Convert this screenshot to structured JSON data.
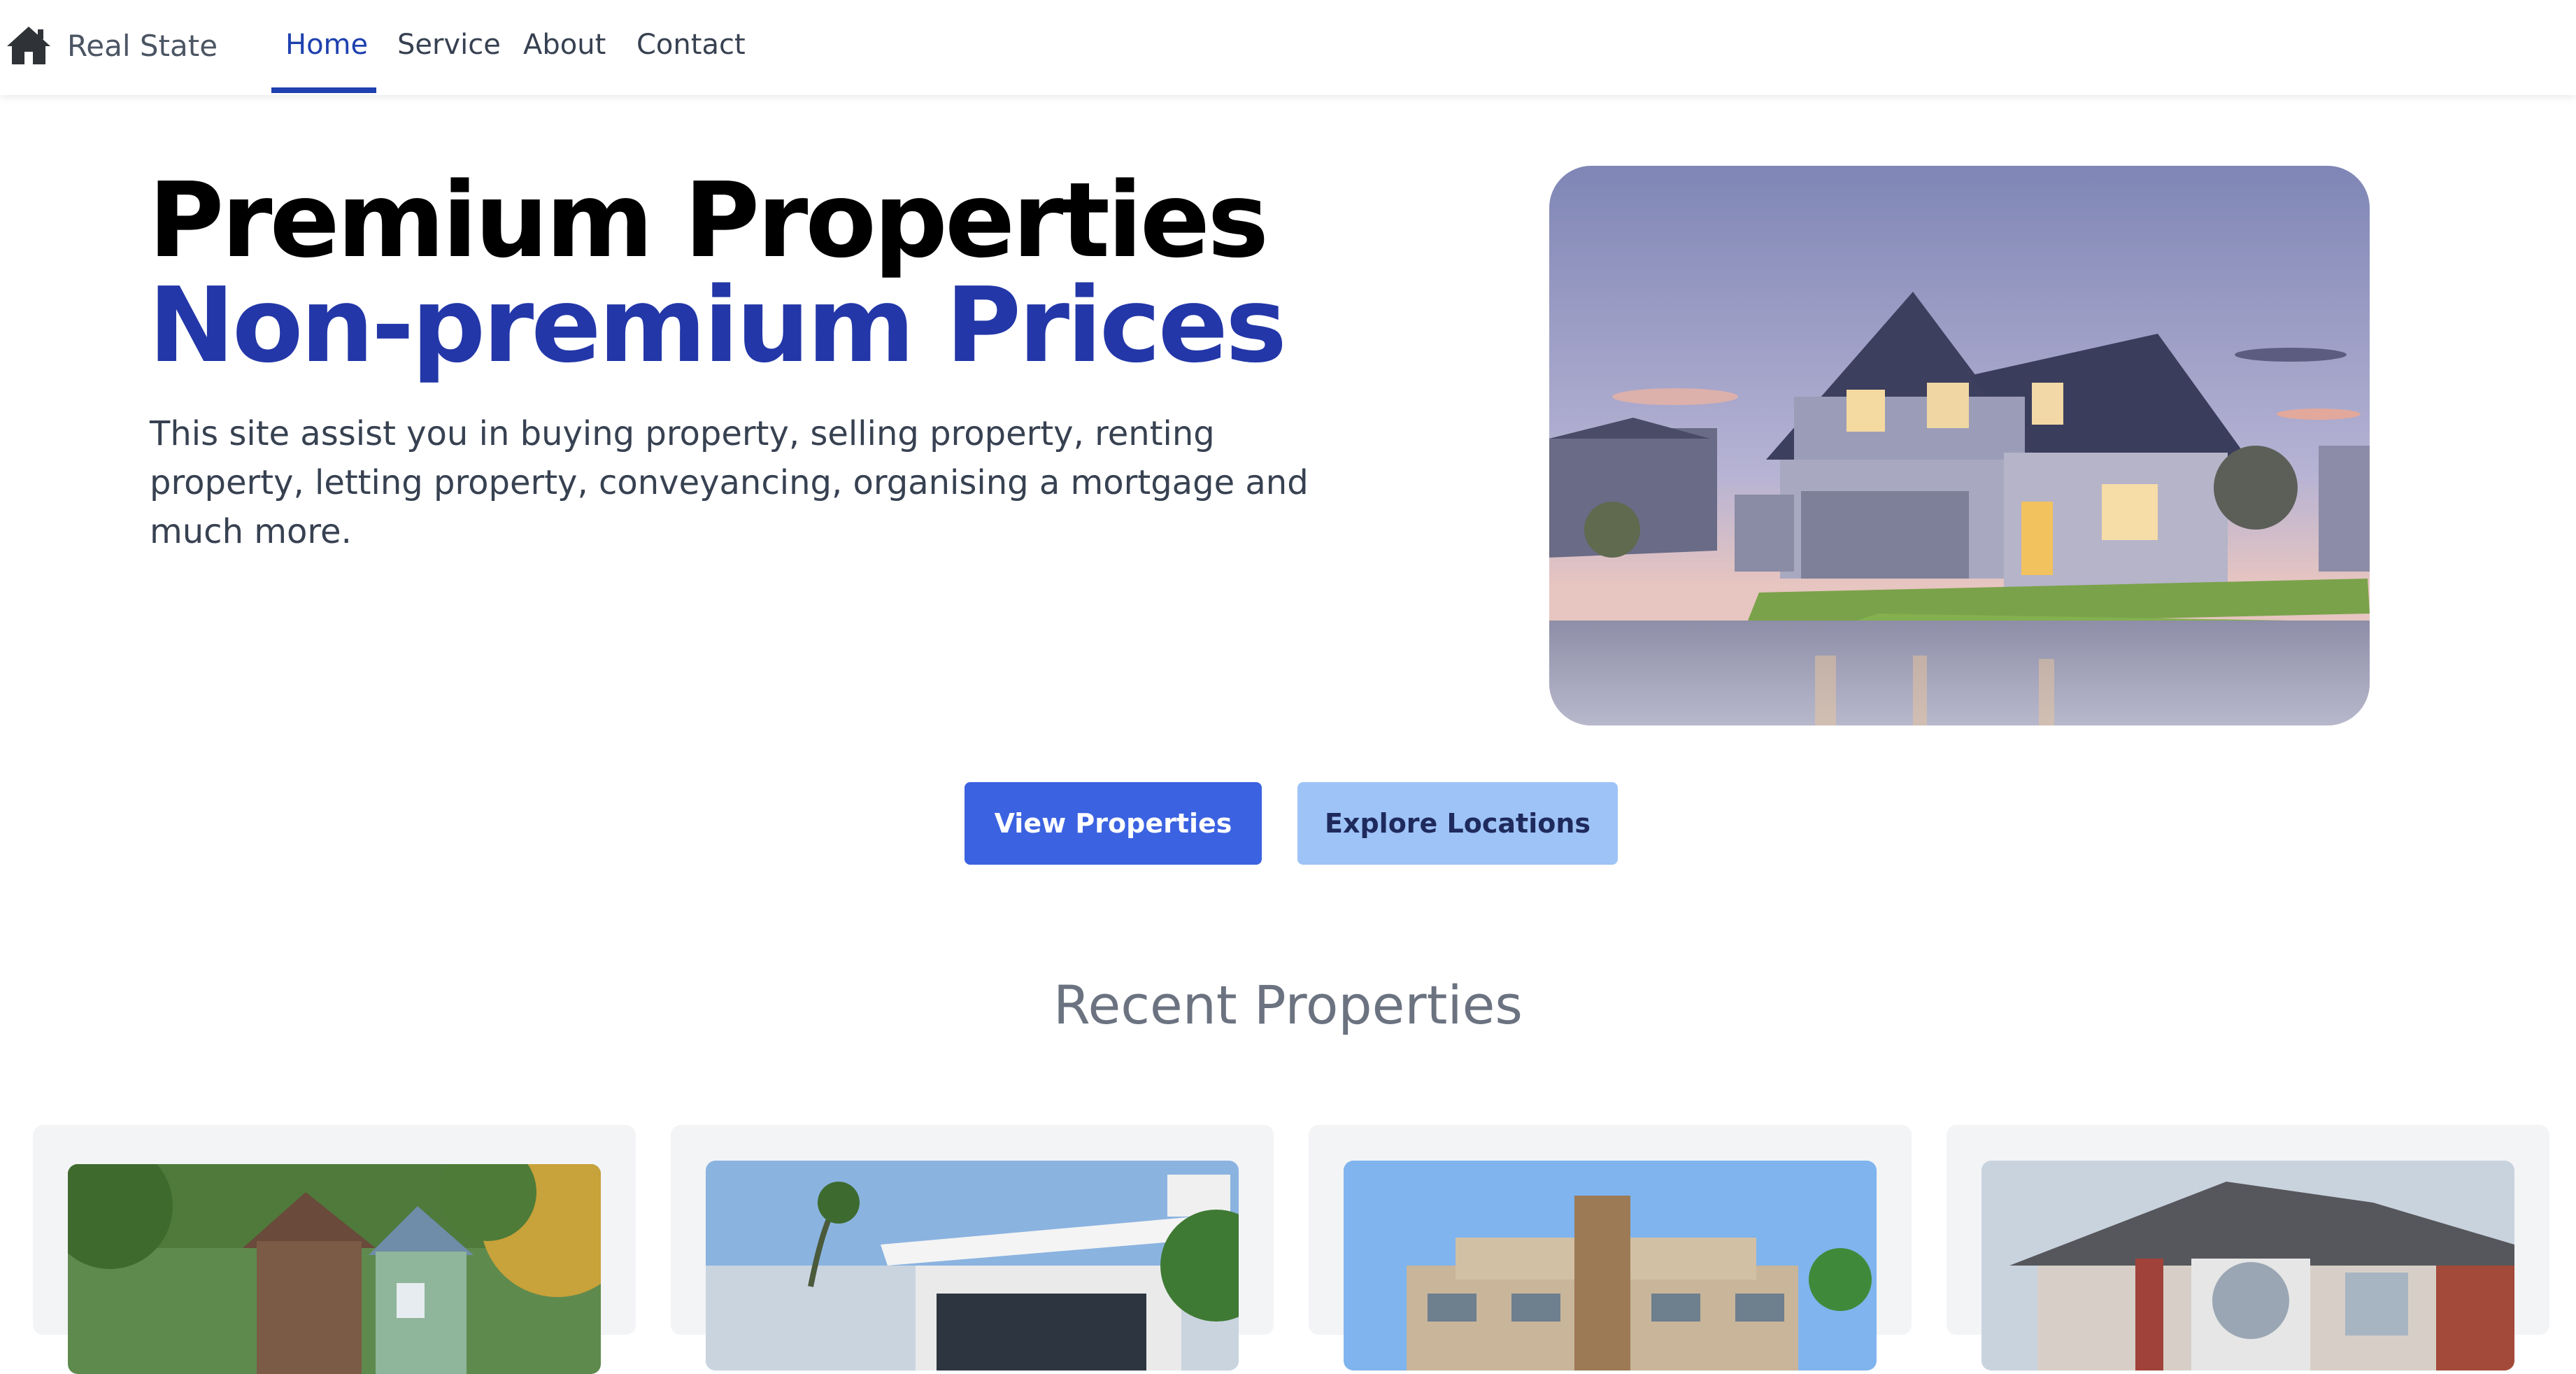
{
  "navbar": {
    "brand": "Real State",
    "brand_icon": "home-icon",
    "links": [
      {
        "label": "Home",
        "active": true
      },
      {
        "label": "Service",
        "active": false
      },
      {
        "label": "About",
        "active": false
      },
      {
        "label": "Contact",
        "active": false
      }
    ]
  },
  "hero": {
    "title_line1": "Premium Properties",
    "title_line2": "Non-premium Prices",
    "description": "This site assist you in buying property, selling property, renting property, letting property, conveyancing, organising a mortgage and much more.",
    "image": "suburban-house-dusk-photo"
  },
  "actions": {
    "primary": "View Properties",
    "secondary": "Explore Locations"
  },
  "recent": {
    "title": "Recent Properties",
    "cards": [
      {
        "image": "wooden-cottage-forest-photo"
      },
      {
        "image": "modern-white-villa-photo"
      },
      {
        "image": "apartment-building-photo"
      },
      {
        "image": "brick-suburban-house-photo"
      }
    ]
  },
  "colors": {
    "accent": "#1e40af",
    "title_blue": "#2337a8",
    "primary_button": "#3b62e0",
    "secondary_button": "#9ec3f7",
    "card_bg": "#f3f4f6"
  }
}
